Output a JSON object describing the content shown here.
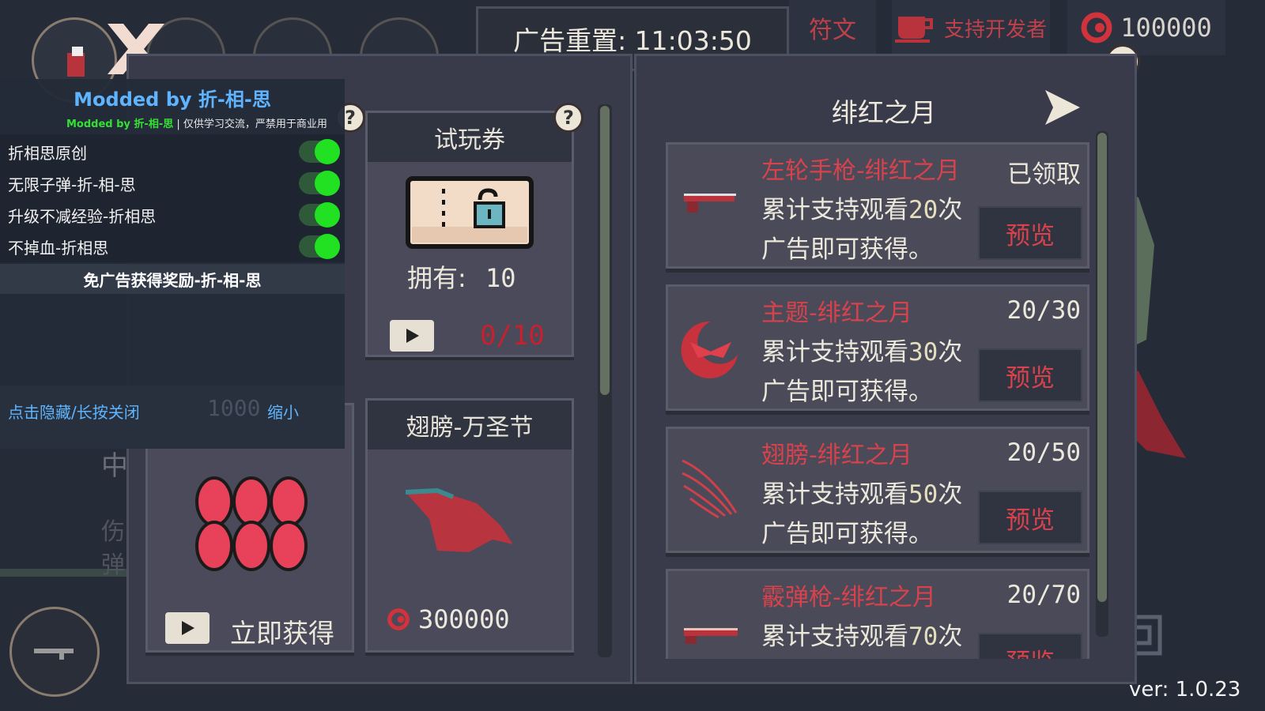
{
  "top": {
    "ad_reset_label": "广告重置: 11:03:50",
    "rune_tab": "符文",
    "support_dev": "支持开发者",
    "currency": "100000"
  },
  "trial": {
    "title": "试玩券",
    "owned_label": "拥有:",
    "owned_count": "10",
    "progress": "0/10"
  },
  "wings_card": {
    "title": "翅膀-万圣节",
    "price": "300000"
  },
  "instant": {
    "label": "立即获得",
    "behind_value": "1000",
    "behind_chars": [
      "中",
      "伤",
      "弹"
    ]
  },
  "event": {
    "title": "绯红之月",
    "rewards": [
      {
        "title": "左轮手枪-绯红之月",
        "desc_prefix": "累计支持观看",
        "count": "20",
        "desc_suffix": "次",
        "desc_line2": "广告即可获得。",
        "status": "已领取",
        "preview": "预览",
        "icon": "revolver-icon"
      },
      {
        "title": "主题-绯红之月",
        "desc_prefix": "累计支持观看",
        "count": "30",
        "desc_suffix": "次",
        "desc_line2": "广告即可获得。",
        "status": "20/30",
        "preview": "预览",
        "icon": "crimson-moon-theme-icon"
      },
      {
        "title": "翅膀-绯红之月",
        "desc_prefix": "累计支持观看",
        "count": "50",
        "desc_suffix": "次",
        "desc_line2": "广告即可获得。",
        "status": "20/50",
        "preview": "预览",
        "icon": "wing-icon"
      },
      {
        "title": "霰弹枪-绯红之月",
        "desc_prefix": "累计支持观看",
        "count": "70",
        "desc_suffix": "次",
        "desc_line2": "",
        "status": "20/70",
        "preview": "预览",
        "icon": "shotgun-icon"
      }
    ]
  },
  "mod_menu": {
    "title": "Modded by 折-相-思",
    "subtitle_brand": "Modded by 折-相-思",
    "subtitle_note": "| 仅供学习交流，严禁用于商业用",
    "toggles": [
      "折相思原创",
      "无限子弹-折-相-思",
      "升级不减经验-折相思",
      "不掉血-折相思"
    ],
    "action": "免广告获得奖励-折-相-思",
    "hide_label": "点击隐藏/长按关闭",
    "minimize_label": "缩小"
  },
  "version": "ver: 1.0.23",
  "colors": {
    "accent_red": "#d8424c",
    "toggle_green": "#22e022",
    "mod_title_blue": "#5fb4ff",
    "mod_brand_green": "#35e035"
  }
}
